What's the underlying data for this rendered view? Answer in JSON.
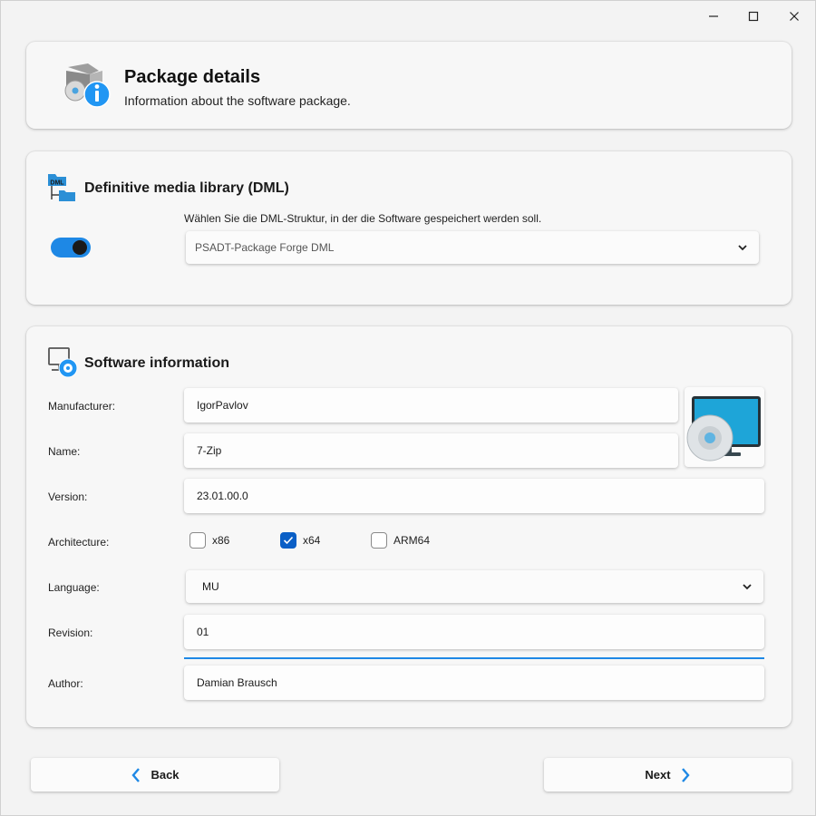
{
  "window": {
    "minimize_glyph": "—",
    "maximize_glyph": "☐",
    "close_glyph": "✕"
  },
  "header": {
    "title": "Package details",
    "subtitle": "Information about the software package.",
    "icon": "package-info-icon"
  },
  "dml": {
    "title": "Definitive media library (DML)",
    "icon": "dml-folder-icon",
    "icon_text": "DML",
    "enabled": true,
    "hint": "Wählen Sie die DML-Struktur, in der die Software gespeichert werden soll.",
    "selected": "PSADT-Package Forge DML"
  },
  "software": {
    "title": "Software information",
    "icon": "software-disc-icon",
    "manufacturer_label": "Manufacturer:",
    "manufacturer_value": "IgorPavlov",
    "name_label": "Name:",
    "name_value": "7-Zip",
    "version_label": "Version:",
    "version_value": "23.01.00.0",
    "architecture_label": "Architecture:",
    "architectures": [
      {
        "label": "x86",
        "checked": false
      },
      {
        "label": "x64",
        "checked": true
      },
      {
        "label": "ARM64",
        "checked": false
      }
    ],
    "language_label": "Language:",
    "language_value": "MU",
    "revision_label": "Revision:",
    "revision_value": "01",
    "author_label": "Author:",
    "author_value": "Damian Brausch",
    "app_image": "monitor-cd-icon"
  },
  "footer": {
    "back_label": "Back",
    "next_label": "Next"
  },
  "colors": {
    "accent": "#1e88e5",
    "checkbox_checked": "#0a5fc6"
  }
}
